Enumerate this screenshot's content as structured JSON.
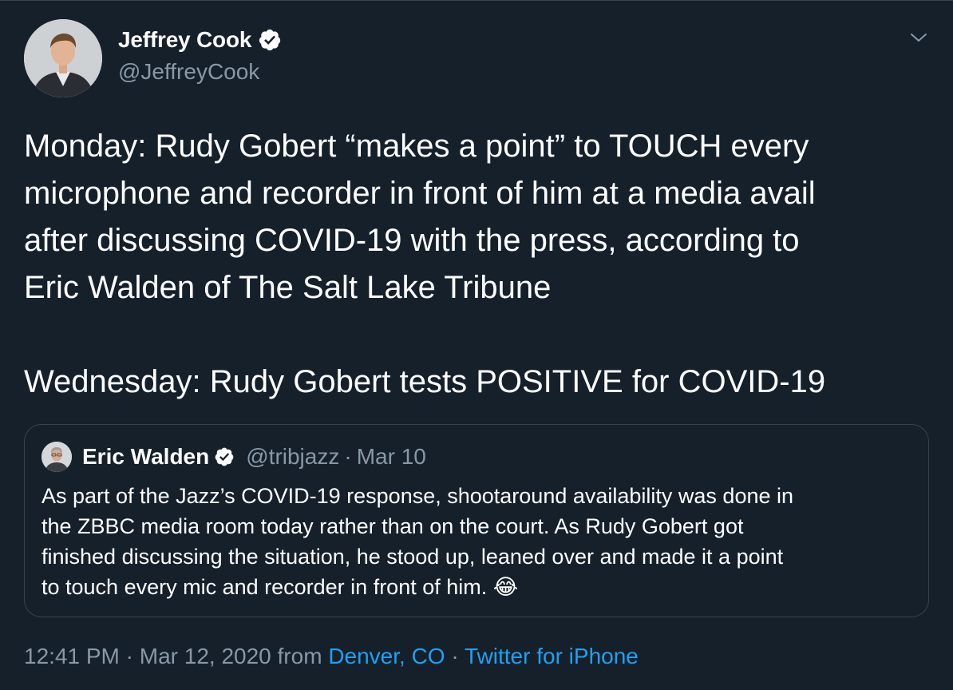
{
  "author": {
    "name": "Jeffrey Cook",
    "handle": "@JeffreyCook"
  },
  "tweet": {
    "lines_part1": [
      "Monday: Rudy Gobert “makes a point” to TOUCH every",
      "microphone and recorder in front of him at a media avail",
      "after discussing COVID-19 with the press, according to",
      "Eric Walden of The Salt Lake Tribune"
    ],
    "line_part2": "Wednesday: Rudy Gobert tests POSITIVE for COVID-19"
  },
  "quoted": {
    "name": "Eric Walden",
    "handle": "@tribjazz",
    "separator": "·",
    "date": "Mar 10",
    "lines": [
      "As part of the Jazz’s COVID-19 response, shootaround availability was done in",
      "the ZBBC media room today rather than on the court. As Rudy Gobert got",
      "finished discussing the situation, he stood up, leaned over and made it a point",
      "to touch every mic and recorder in front of him. "
    ],
    "emoji": "😂"
  },
  "meta": {
    "time": "12:41 PM",
    "sep1": "·",
    "date": "Mar 12, 2020",
    "from": "from",
    "location": "Denver, CO",
    "sep2": "·",
    "source": "Twitter for iPhone"
  },
  "icons": {
    "verified": "verified-badge-icon",
    "chevron": "chevron-down-icon"
  },
  "colors": {
    "background": "#15202b",
    "secondary_text": "#8899a6",
    "link": "#1da1f2",
    "border": "#38444d"
  }
}
